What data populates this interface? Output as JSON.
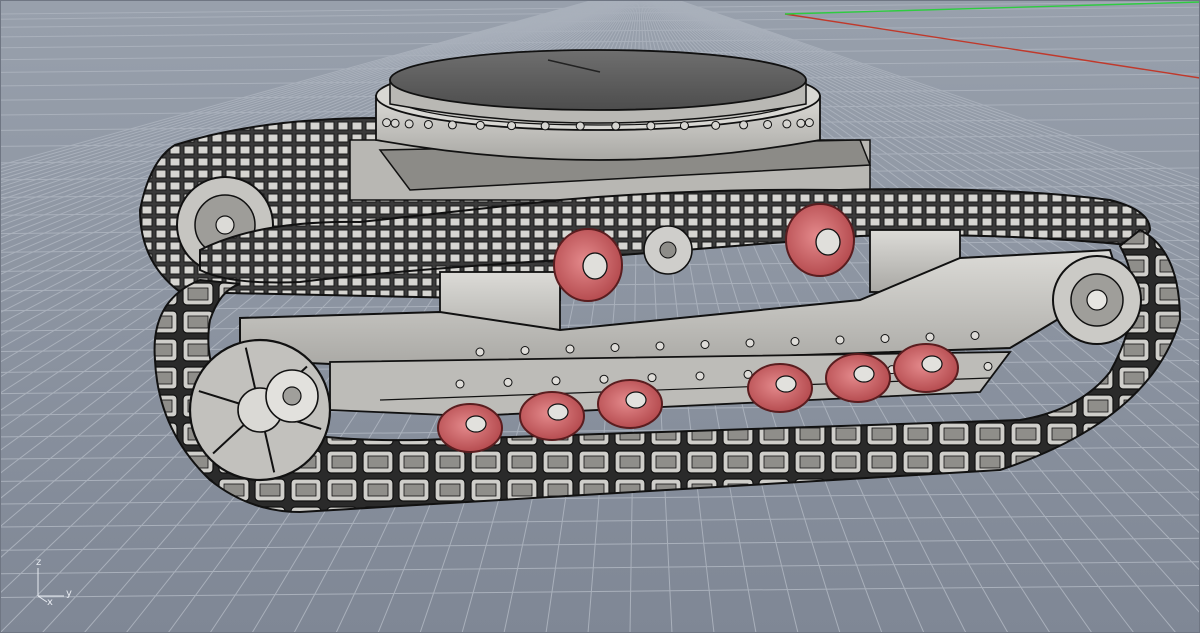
{
  "viewport": {
    "axis_labels": {
      "z": "z",
      "y": "y",
      "x": "x"
    },
    "colors": {
      "background_top": "#98a0ac",
      "background_bottom": "#7f8795",
      "grid_line": "#a9b0bb",
      "x_axis": "#c0392b",
      "y_axis": "#2ecc40",
      "wheel": "#c9595c",
      "body": "#c7c6c2",
      "outline": "#1b1b1b"
    }
  }
}
